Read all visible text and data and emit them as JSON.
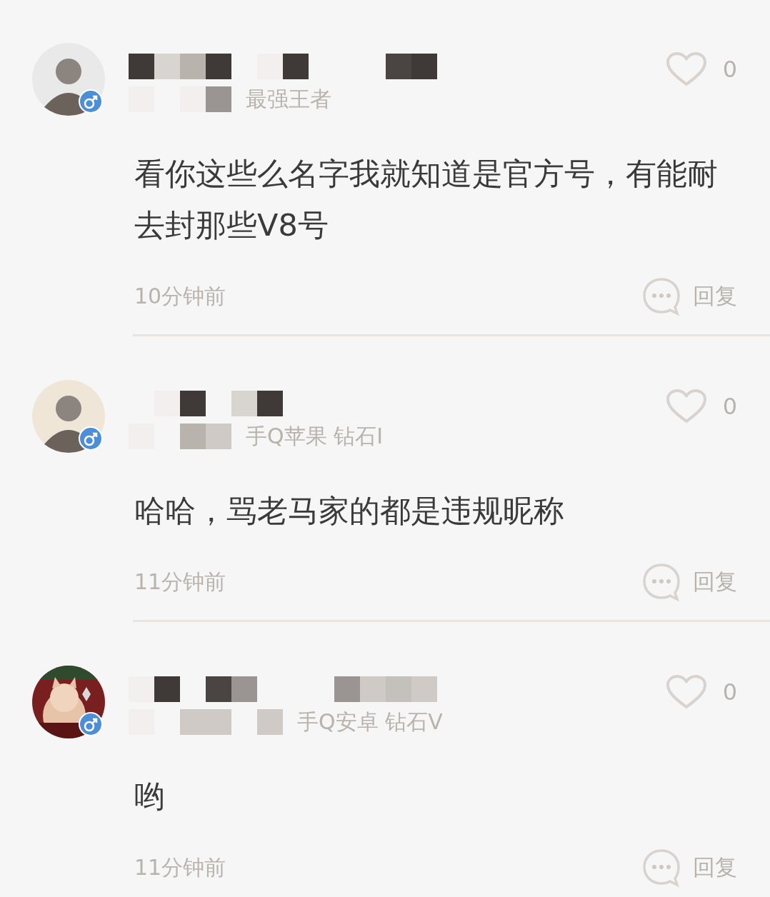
{
  "comments": [
    {
      "avatar": {
        "kind": "silhouette"
      },
      "rank": "最强王者",
      "likes": "0",
      "body": "看你这些么名字我就知道是官方号，有能耐去封那些V8号",
      "time": "10分钟前",
      "reply": "回复"
    },
    {
      "avatar": {
        "kind": "silhouette"
      },
      "rank": "手Q苹果 钻石I",
      "likes": "0",
      "body": "哈哈，骂老马家的都是违规昵称",
      "time": "11分钟前",
      "reply": "回复"
    },
    {
      "rank": "手Q安卓 钻石V",
      "likes": "0",
      "body": "哟",
      "time": "11分钟前",
      "reply": "回复"
    }
  ]
}
